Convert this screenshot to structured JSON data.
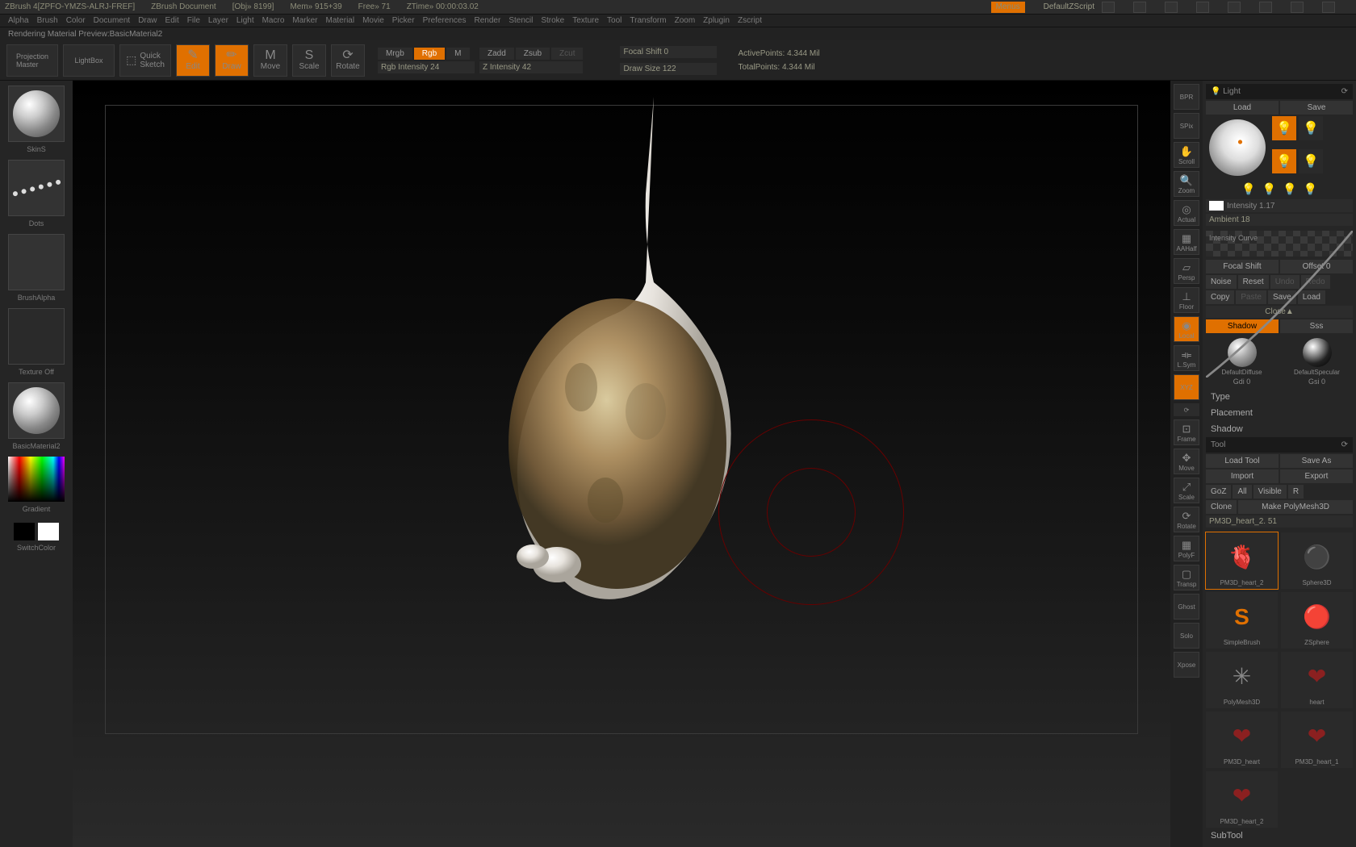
{
  "title": {
    "app": "ZBrush 4[ZPFO-YMZS-ALRJ-FREF]",
    "doc": "ZBrush Document",
    "obj": "[Obj» 8199]",
    "mem": "Mem» 915+39",
    "free": "Free» 71",
    "ztime": "ZTime» 00:00:03.02",
    "menus": "Menus",
    "script": "DefaultZScript"
  },
  "menubar": [
    "Alpha",
    "Brush",
    "Color",
    "Document",
    "Draw",
    "Edit",
    "File",
    "Layer",
    "Light",
    "Macro",
    "Marker",
    "Material",
    "Movie",
    "Picker",
    "Preferences",
    "Render",
    "Stencil",
    "Stroke",
    "Texture",
    "Tool",
    "Transform",
    "Zoom",
    "Zplugin",
    "Zscript"
  ],
  "statusline": "Rendering Material Preview:BasicMaterial2",
  "topshelf": {
    "projectionMaster": "Projection\nMaster",
    "lightbox": "LightBox",
    "quickSketch": "Quick\nSketch",
    "edit": "Edit",
    "draw": "Draw",
    "move": "Move",
    "scale": "Scale",
    "rotate": "Rotate"
  },
  "modes": {
    "mrgb": "Mrgb",
    "rgb": "Rgb",
    "m": "M",
    "zadd": "Zadd",
    "zsub": "Zsub",
    "zcut": "Zcut"
  },
  "sliders": {
    "rgbInt": "Rgb Intensity 24",
    "zInt": "Z Intensity 42",
    "focal": "Focal Shift 0",
    "drawsize": "Draw Size 122"
  },
  "stats": {
    "active": "ActivePoints: 4.344 Mil",
    "total": "TotalPoints: 4.344 Mil"
  },
  "leftTray": {
    "skin": "SkinS",
    "dots": "Dots",
    "brushAlpha": "BrushAlpha",
    "textureOff": "Texture Off",
    "material": "BasicMaterial2",
    "gradient": "Gradient",
    "switchColor": "SwitchColor"
  },
  "rightIcons": {
    "bpr": "BPR",
    "spix": "SPix",
    "scroll": "Scroll",
    "zoom": "Zoom",
    "actual": "Actual",
    "aahalf": "AAHalf",
    "persp": "Persp",
    "floor": "Floor",
    "local": "Local",
    "lsym": "L.Sym",
    "xyz": "XYZ",
    "frame": "Frame",
    "move": "Move",
    "scale": "Scale",
    "rotate": "Rotate",
    "polyf": "PolyF",
    "transp": "Transp",
    "ghost": "Ghost",
    "solo": "Solo",
    "xpose": "Xpose"
  },
  "light": {
    "header": "Light",
    "load": "Load",
    "save": "Save",
    "intensity": "Intensity 1.17",
    "ambient": "Ambient 18",
    "curveLbl": "Intensity Curve",
    "focal": "Focal Shift",
    "offset": "Offset 0",
    "noise": "Noise",
    "reset": "Reset",
    "undo": "Undo",
    "redo": "Redo",
    "copy": "Copy",
    "paste": "Paste",
    "savecurve": "Save",
    "loadcurve": "Load",
    "close": "Close▲",
    "shadow": "Shadow",
    "sss": "Sss",
    "defDiffuse": "DefaultDiffuse",
    "defSpecular": "DefaultSpecular",
    "gdi": "Gdi 0",
    "gsi": "Gsi 0",
    "type": "Type",
    "placement": "Placement",
    "shadowSec": "Shadow"
  },
  "tool": {
    "header": "Tool",
    "loadTool": "Load Tool",
    "saveAs": "Save As",
    "import": "Import",
    "export": "Export",
    "goz": "GoZ",
    "all": "All",
    "visible": "Visible",
    "r": "R",
    "clone": "Clone",
    "makePoly": "Make PolyMesh3D",
    "name": "PM3D_heart_2. 51",
    "items": [
      {
        "lbl": "PM3D_heart_2",
        "kind": "heart"
      },
      {
        "lbl": "Sphere3D",
        "kind": "sphere"
      },
      {
        "lbl": "SimpleBrush",
        "kind": "brush"
      },
      {
        "lbl": "ZSphere",
        "kind": "zsphere"
      },
      {
        "lbl": "PolyMesh3D",
        "kind": "star"
      },
      {
        "lbl": "heart",
        "kind": "heart2"
      },
      {
        "lbl": "PM3D_heart",
        "kind": "heart2"
      },
      {
        "lbl": "PM3D_heart_1",
        "kind": "heart2"
      },
      {
        "lbl": "PM3D_heart_2",
        "kind": "heart2"
      }
    ],
    "subtool": "SubTool"
  }
}
